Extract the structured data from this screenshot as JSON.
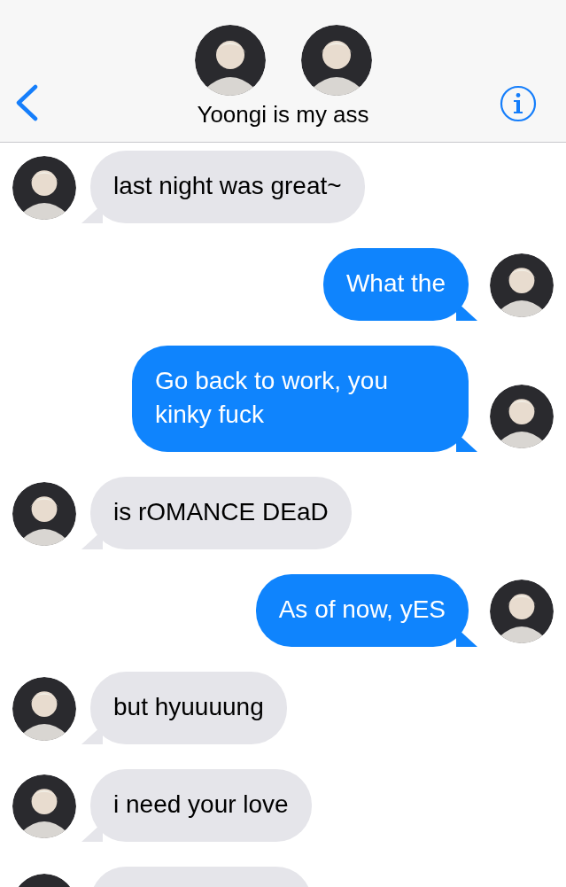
{
  "header": {
    "title": "Yoongi is my ass",
    "participants": [
      {
        "kind": "avatar"
      },
      {
        "kind": "avatar"
      }
    ]
  },
  "messages": [
    {
      "kind": "incoming",
      "text": "last night was great~"
    },
    {
      "kind": "outgoing",
      "text": "What the"
    },
    {
      "kind": "outgoing",
      "text": "Go back to work, you kinky fuck"
    },
    {
      "kind": "incoming",
      "text": "is rOMANCE DEaD"
    },
    {
      "kind": "outgoing",
      "text": "As of now, yES"
    },
    {
      "kind": "incoming",
      "text": "but hyuuuung"
    },
    {
      "kind": "incoming",
      "text": "i need your love"
    },
    {
      "kind": "incoming"
    }
  ]
}
